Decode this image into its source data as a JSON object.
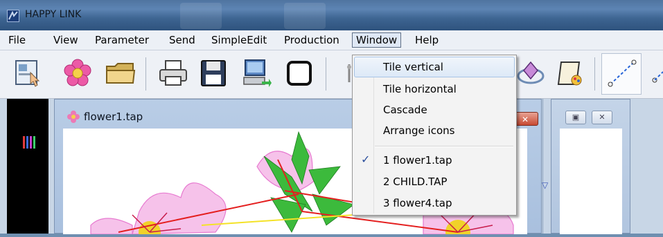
{
  "window": {
    "title": "HAPPY LINK",
    "icon": "app-logo-icon"
  },
  "menubar": {
    "items": [
      {
        "label": "File",
        "name": "menu-file"
      },
      {
        "label": "View",
        "name": "menu-view"
      },
      {
        "label": "Parameter",
        "name": "menu-parameter"
      },
      {
        "label": "Send",
        "name": "menu-send"
      },
      {
        "label": "SimpleEdit",
        "name": "menu-simpleedit"
      },
      {
        "label": "Production",
        "name": "menu-production"
      },
      {
        "label": "Window",
        "name": "menu-window",
        "active": true
      },
      {
        "label": "Help",
        "name": "menu-help"
      }
    ]
  },
  "toolbar": {
    "icons": [
      "design-touch-icon",
      "flower-icon",
      "folder-icon",
      "printer-icon",
      "floppy-save-icon",
      "computer-send-icon",
      "frame-icon",
      "rotate-gem-icon",
      "scroll-paint-icon",
      "line-draw-icon"
    ]
  },
  "window_menu": {
    "items": [
      {
        "label": "Tile vertical",
        "hover": true
      },
      {
        "label": "Tile horizontal"
      },
      {
        "label": "Cascade"
      },
      {
        "label": "Arrange icons"
      }
    ],
    "documents": [
      {
        "label": "1 flower1.tap",
        "checked": true
      },
      {
        "label": "2 CHILD.TAP"
      },
      {
        "label": "3 flower4.tap"
      }
    ]
  },
  "child_window": {
    "title": "flower1.tap",
    "icon": "flower-icon"
  },
  "colors": {
    "accent": "#5d84b3",
    "menu_bg": "#f3f3f3",
    "palette_bg": "#000000"
  }
}
